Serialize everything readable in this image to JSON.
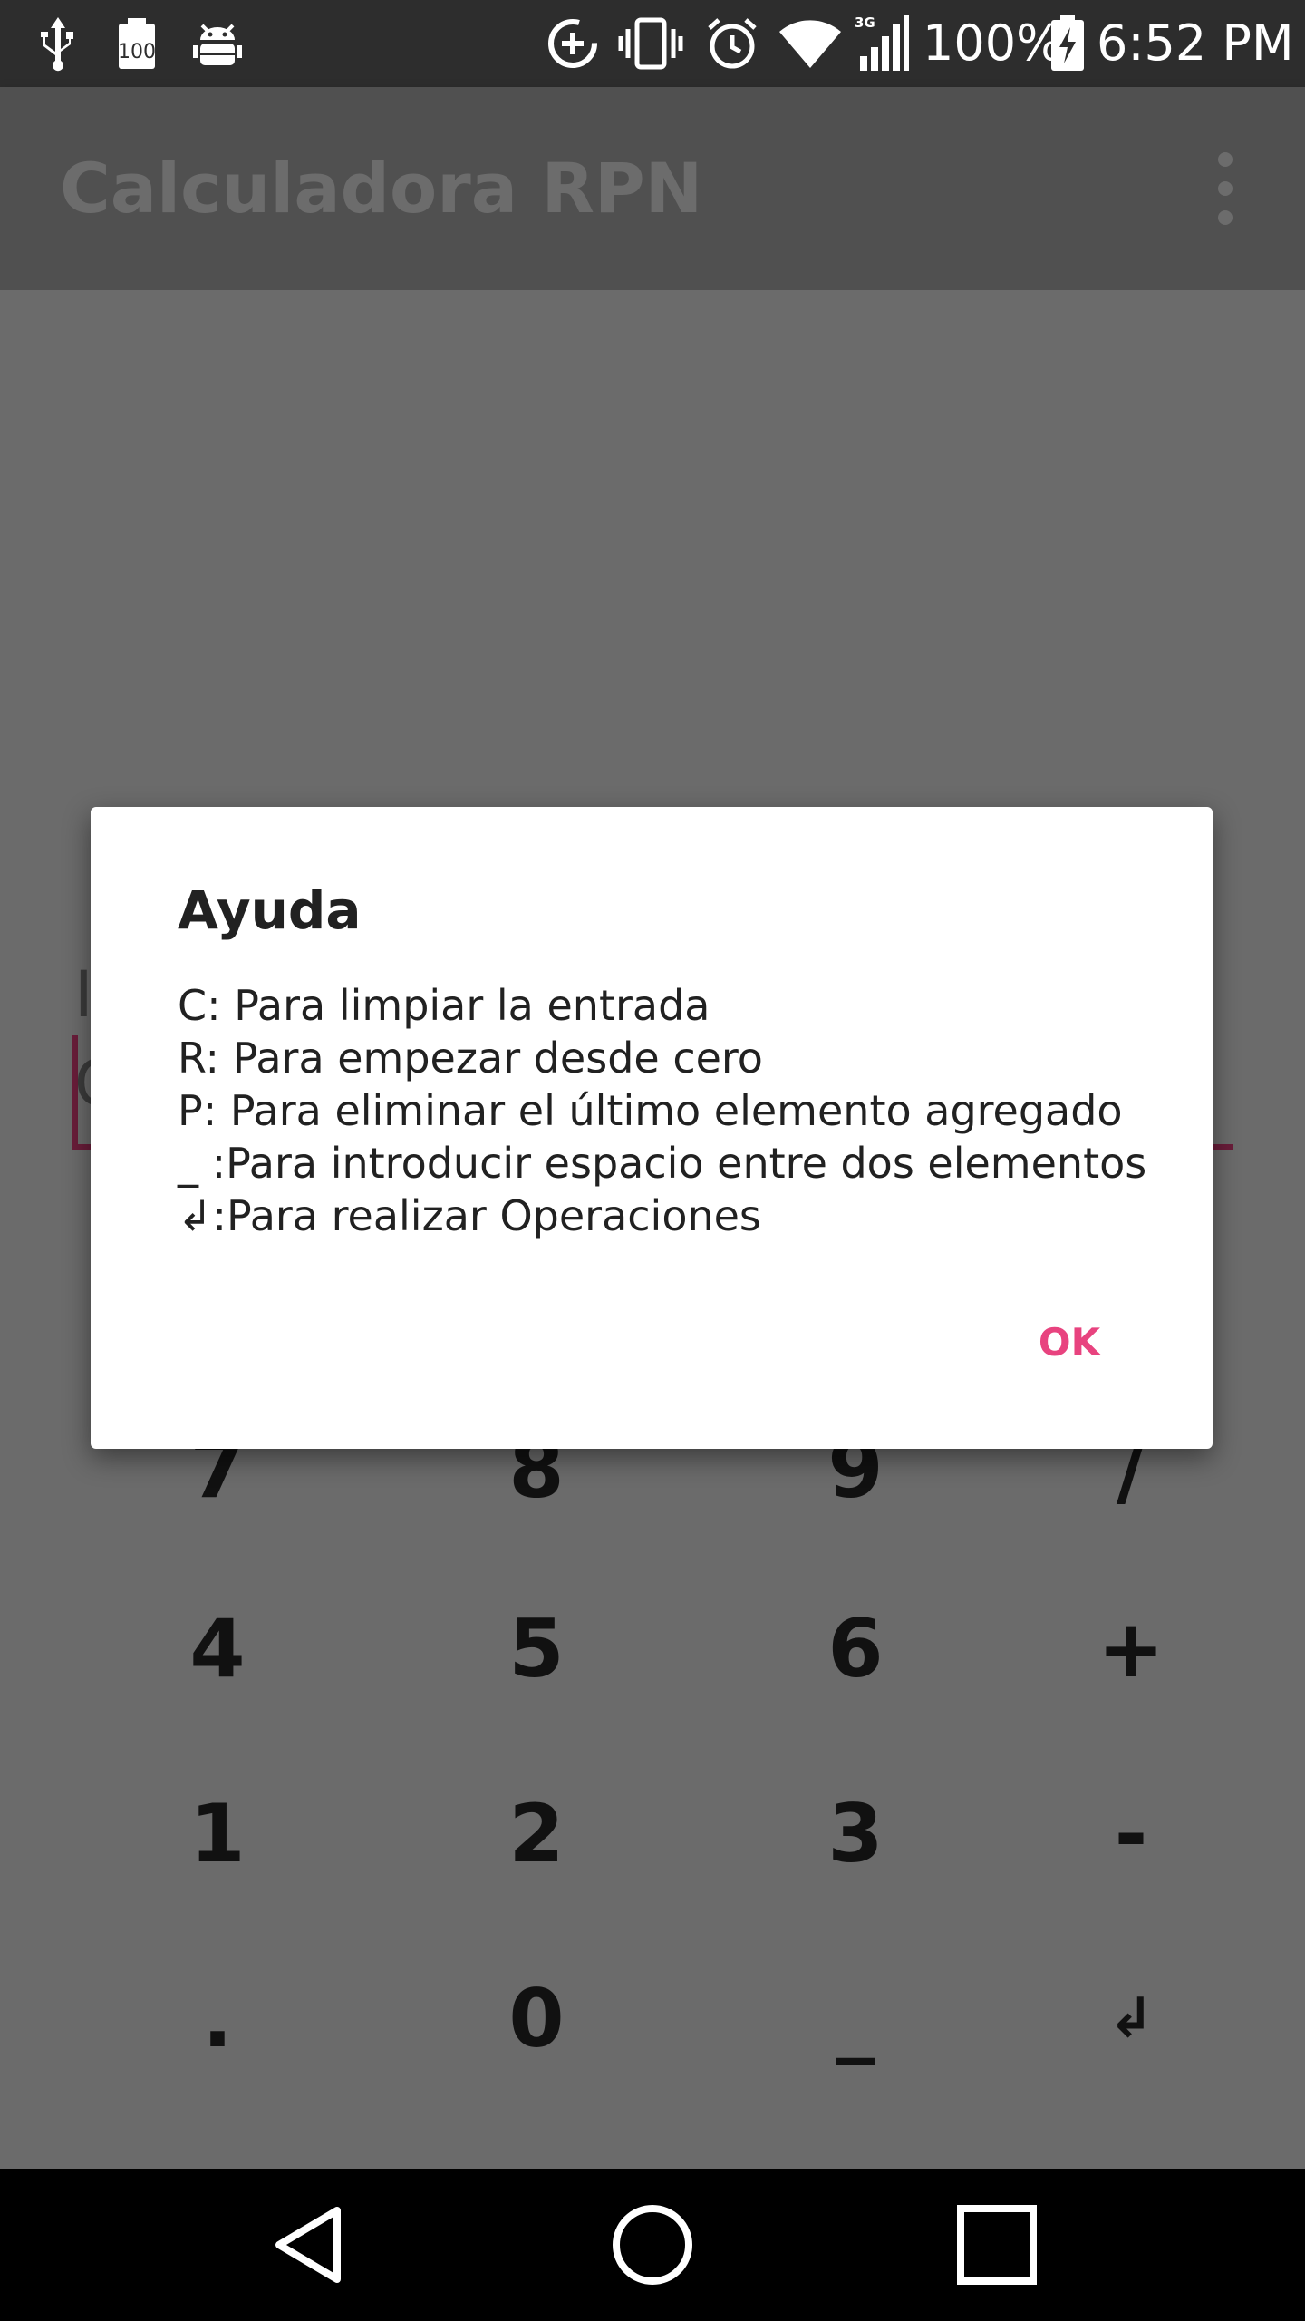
{
  "status_bar": {
    "battery_text": "100%",
    "time": "6:52 PM",
    "icons": [
      "usb-icon",
      "battery-100-badge-icon",
      "android-bug-icon",
      "data-saver-icon",
      "vibrate-icon",
      "alarm-icon",
      "wifi-icon",
      "signal-3g-icon",
      "battery-charging-icon"
    ],
    "badge_100": "100",
    "network_label": "3G"
  },
  "app_bar": {
    "title": "Calculadora RPN",
    "menu_icon": "overflow-menu-icon"
  },
  "background": {
    "peek_line1": "I",
    "peek_line2": "C"
  },
  "keypad": {
    "rows": [
      [
        "7",
        "8",
        "9",
        "/"
      ],
      [
        "4",
        "5",
        "6",
        "+"
      ],
      [
        "1",
        "2",
        "3",
        "-"
      ],
      [
        ".",
        "0",
        "_",
        "↲"
      ]
    ]
  },
  "dialog": {
    "title": "Ayuda",
    "lines": [
      "C: Para limpiar la entrada",
      "R: Para empezar desde cero",
      "P: Para eliminar el último elemento agregado",
      "_ :Para introducir espacio entre dos elementos",
      "↲:Para realizar Operaciones"
    ],
    "ok_label": "OK",
    "accent_color": "#e8437f"
  },
  "nav_bar": {
    "icons": [
      "back-icon",
      "home-icon",
      "recents-icon"
    ]
  }
}
